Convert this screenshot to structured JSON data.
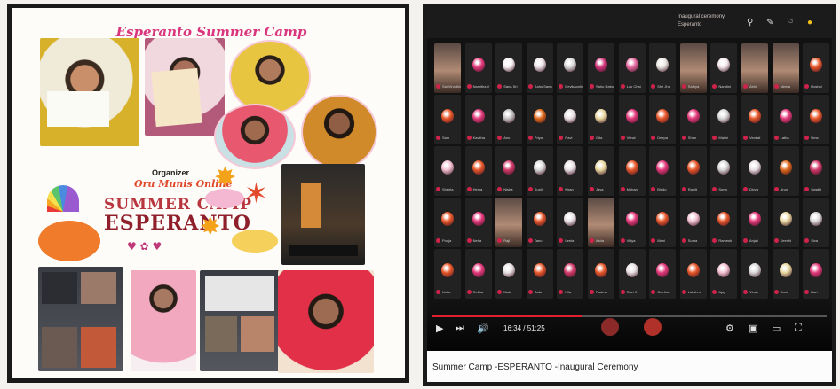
{
  "poster": {
    "title": "Esperanto Summer Camp",
    "tiny_caption": "",
    "organizer_label": "Organizer",
    "organizer_name": "Oru Munis Online",
    "word_art_top": "SUMMER CAMP",
    "word_art_bottom": "ESPERANTO"
  },
  "video": {
    "host_line1": "Inaugural ceremony",
    "host_line2": "Esperanto",
    "time_display": "16:34 / 51:25",
    "caption": "Summer Camp -ESPERANTO -Inaugural Ceremony",
    "progress_fraction": 0.38,
    "accent_color": "#e01f2f",
    "controls": {
      "play": "play-icon",
      "next": "next-icon",
      "volume": "volume-icon",
      "settings": "gear-icon",
      "miniplayer": "miniplayer-icon",
      "theater": "theater-icon",
      "fullscreen": "fullscreen-icon"
    },
    "participants": [
      {
        "name": "Sai Vinodhini",
        "color": "#e43a7c",
        "video": true
      },
      {
        "name": "Namitha V",
        "color": "#e43a7c"
      },
      {
        "name": "Sana Sri",
        "color": "#f6f0f2"
      },
      {
        "name": "Sahu Sanu",
        "color": "#e8e0e4"
      },
      {
        "name": "Devikaonline",
        "color": "#d8d8d8"
      },
      {
        "name": "Sahu Ratna",
        "color": "#d2357b"
      },
      {
        "name": "Lou Chai",
        "color": "#e86aa0"
      },
      {
        "name": "Shri Jha",
        "color": "#e8e6e0"
      },
      {
        "name": "Sathya",
        "color": "#d24a8a",
        "video": true
      },
      {
        "name": "Nandini",
        "color": "#f2e8ec"
      },
      {
        "name": "Abhi",
        "color": "#e43a7c",
        "video": true
      },
      {
        "name": "Meera",
        "color": "#e8e0e4",
        "video": true
      },
      {
        "name": "Roshni",
        "color": "#e8582a"
      },
      {
        "name": "Sam",
        "color": "#e8582a"
      },
      {
        "name": "Kavitha",
        "color": "#e43a7c"
      },
      {
        "name": "Anu",
        "color": "#c4c4c4"
      },
      {
        "name": "Priya",
        "color": "#e06a1a"
      },
      {
        "name": "Ravi",
        "color": "#e8e0e4"
      },
      {
        "name": "Gita",
        "color": "#e8d8a0"
      },
      {
        "name": "Vimal",
        "color": "#e43a7c"
      },
      {
        "name": "Deepa",
        "color": "#e8582a"
      },
      {
        "name": "Shan",
        "color": "#e43a7c"
      },
      {
        "name": "Malini",
        "color": "#d8d8d8"
      },
      {
        "name": "Venkat",
        "color": "#e8582a"
      },
      {
        "name": "Latha",
        "color": "#e43a7c"
      },
      {
        "name": "Uma",
        "color": "#e8582a"
      },
      {
        "name": "Sheela",
        "color": "#f2c2d2"
      },
      {
        "name": "Hema",
        "color": "#e8582a"
      },
      {
        "name": "Nisha",
        "color": "#d23a6a"
      },
      {
        "name": "Sunil",
        "color": "#d8d8d8"
      },
      {
        "name": "Kiran",
        "color": "#e8e0e4"
      },
      {
        "name": "Jaya",
        "color": "#e8d8a0"
      },
      {
        "name": "Mohan",
        "color": "#e8582a"
      },
      {
        "name": "Bindu",
        "color": "#e43a7c"
      },
      {
        "name": "Ranjit",
        "color": "#e8582a"
      },
      {
        "name": "Sona",
        "color": "#d8d8d8"
      },
      {
        "name": "Divya",
        "color": "#e8e0e4"
      },
      {
        "name": "Arun",
        "color": "#e06a1a"
      },
      {
        "name": "Swathi",
        "color": "#d23a6a"
      },
      {
        "name": "Pooja",
        "color": "#e8582a"
      },
      {
        "name": "Neha",
        "color": "#e43a7c"
      },
      {
        "name": "Raji",
        "color": "#e8e0e4",
        "video": true
      },
      {
        "name": "Tanu",
        "color": "#e8582a"
      },
      {
        "name": "Leela",
        "color": "#e8e0e4"
      },
      {
        "name": "Asha",
        "color": "#d23a6a",
        "video": true
      },
      {
        "name": "Vidya",
        "color": "#e43a7c"
      },
      {
        "name": "Mani",
        "color": "#e8582a"
      },
      {
        "name": "Suma",
        "color": "#f2c2d2"
      },
      {
        "name": "Ramesh",
        "color": "#e8582a"
      },
      {
        "name": "Anjali",
        "color": "#e43a7c"
      },
      {
        "name": "Keerthi",
        "color": "#e8d8a0"
      },
      {
        "name": "Siva",
        "color": "#d8d8d8"
      },
      {
        "name": "Usha",
        "color": "#e8582a"
      },
      {
        "name": "Rekha",
        "color": "#e43a7c"
      },
      {
        "name": "Mala",
        "color": "#e8e0e4"
      },
      {
        "name": "Bala",
        "color": "#e8582a"
      },
      {
        "name": "Nila",
        "color": "#d23a6a"
      },
      {
        "name": "Padma",
        "color": "#e8582a"
      },
      {
        "name": "Ravi K",
        "color": "#e8e0e4"
      },
      {
        "name": "Geetha",
        "color": "#e43a7c"
      },
      {
        "name": "Lakshmi",
        "color": "#e8582a"
      },
      {
        "name": "Ajay",
        "color": "#f2c2d2"
      },
      {
        "name": "Vinay",
        "color": "#d8d8d8"
      },
      {
        "name": "Rani",
        "color": "#e8d8a0"
      },
      {
        "name": "Hari",
        "color": "#e43a7c"
      }
    ]
  }
}
